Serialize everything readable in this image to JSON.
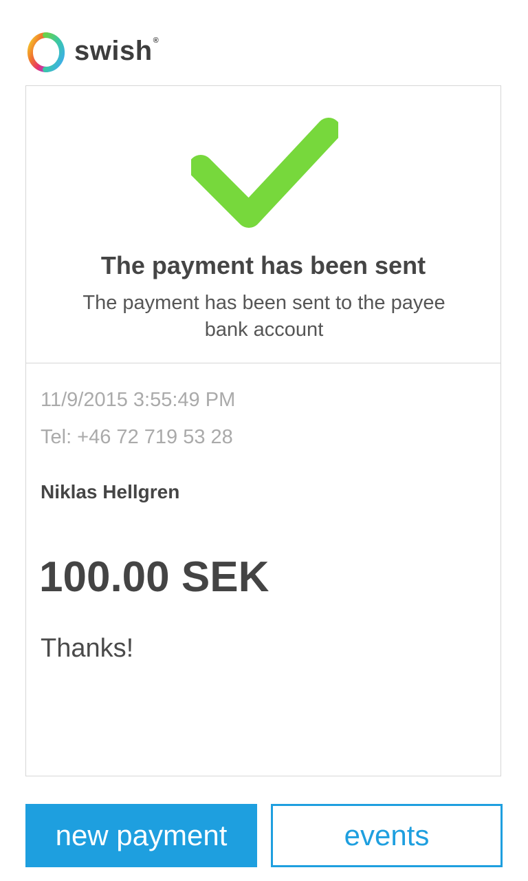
{
  "header": {
    "brand": "swish",
    "brand_mark": "®"
  },
  "status": {
    "icon": "checkmark-icon",
    "title": "The payment has been sent",
    "description": "The payment has been sent to the payee bank account"
  },
  "details": {
    "datetime": "11/9/2015 3:55:49 PM",
    "phone": "Tel: +46 72 719 53 28",
    "payee": "Niklas Hellgren",
    "amount": "100.00 SEK",
    "message": "Thanks!"
  },
  "actions": {
    "new_payment": "new payment",
    "events": "events"
  },
  "colors": {
    "accent": "#1e9fdf",
    "success": "#77d83c",
    "muted_text": "#aaaaaa",
    "border": "#d6d6d6"
  }
}
